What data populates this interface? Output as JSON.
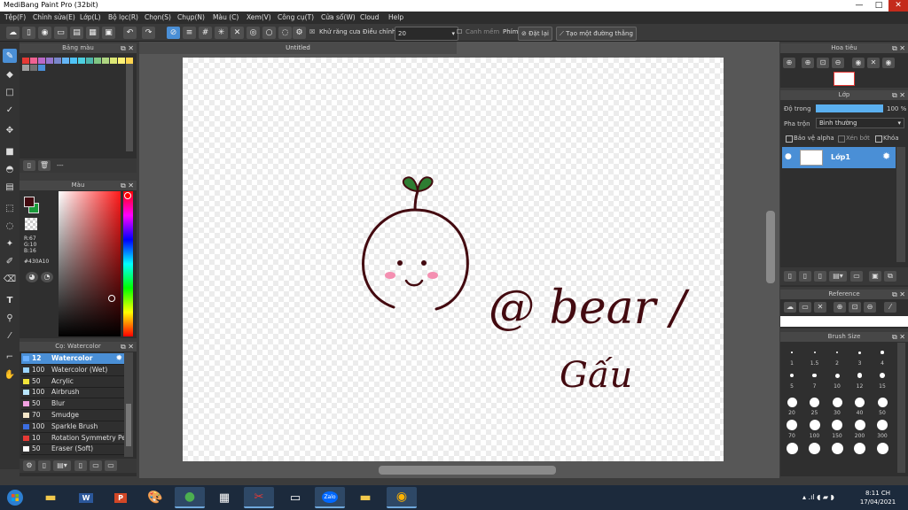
{
  "window": {
    "title": "MediBang Paint Pro (32bit)",
    "min": "—",
    "max": "□",
    "close": "✕"
  },
  "menu": [
    "Tệp(F)",
    "Chỉnh sửa(E)",
    "Lớp(L)",
    "Bộ lọc(R)",
    "Chọn(S)",
    "Chụp(N)",
    "Màu (C)",
    "Xem(V)",
    "Công cụ(T)",
    "Cửa sổ(W)",
    "Cloud",
    "Help"
  ],
  "toolbar": {
    "antialias": "Khử răng cưa",
    "correction_label": "Điều chỉnh",
    "correction_value": "20",
    "smooth": "Canh mềm",
    "key_label": "Phím",
    "reset": "Đặt lại",
    "make_line": "Tạo một đường thẳng"
  },
  "palette": {
    "title": "Bảng màu",
    "dash": "---",
    "swatches": [
      "#e53935",
      "#f06292",
      "#ba68c8",
      "#9575cd",
      "#7986cb",
      "#64b5f6",
      "#4fc3f7",
      "#4dd0e1",
      "#4db6ac",
      "#81c784",
      "#aed581",
      "#dce775",
      "#fff176",
      "#ffd54f",
      "#a0a0a0",
      "#707070",
      "#4a90d9"
    ]
  },
  "color": {
    "title": "Màu",
    "r": "R:67",
    "g": "G:10",
    "b": "B:16",
    "hex": "#430A10",
    "primary": "#430a10",
    "secondary": "#1a9a3a"
  },
  "brush": {
    "title": "Cọ: Watercolor",
    "items": [
      {
        "size": "12",
        "name": "Watercolor",
        "color": "#6ab0ff"
      },
      {
        "size": "100",
        "name": "Watercolor (Wet)",
        "color": "#9ad4ff"
      },
      {
        "size": "50",
        "name": "Acrylic",
        "color": "#f2e53a"
      },
      {
        "size": "100",
        "name": "Airbrush",
        "color": "#b9e6ff"
      },
      {
        "size": "50",
        "name": "Blur",
        "color": "#f0a0e0"
      },
      {
        "size": "70",
        "name": "Smudge",
        "color": "#f5e6c8"
      },
      {
        "size": "100",
        "name": "Sparkle Brush",
        "color": "#3b6de0"
      },
      {
        "size": "10",
        "name": "Rotation Symmetry Per",
        "color": "#e53935"
      },
      {
        "size": "50",
        "name": "Eraser (Soft)",
        "color": "#ffffff"
      }
    ]
  },
  "canvas": {
    "tab": "Untitled",
    "text1": "@ bear /",
    "text2": "Gấu",
    "ink": "#430a10",
    "leaf": "#2e7d32",
    "blush": "#f48fb1"
  },
  "navigator": {
    "title": "Hoa tiêu"
  },
  "layer": {
    "title": "Lớp",
    "opacity_label": "Độ trong",
    "opacity_value": "100 %",
    "opacity": 100,
    "blend_label": "Pha trộn",
    "blend_value": "Bình thường",
    "protect_alpha": "Bảo vệ alpha",
    "clipping": "Xén bớt",
    "lock": "Khóa",
    "name": "Lớp1"
  },
  "reference": {
    "title": "Reference"
  },
  "brush_size": {
    "title": "Brush Size",
    "sizes": [
      "1",
      "1.5",
      "2",
      "3",
      "4",
      "5",
      "7",
      "10",
      "12",
      "15",
      "20",
      "25",
      "30",
      "40",
      "50",
      "70",
      "100",
      "150",
      "200",
      "300"
    ]
  },
  "taskbar": {
    "time": "8:11 CH",
    "date": "17/04/2021",
    "zalo": "Zalo"
  }
}
